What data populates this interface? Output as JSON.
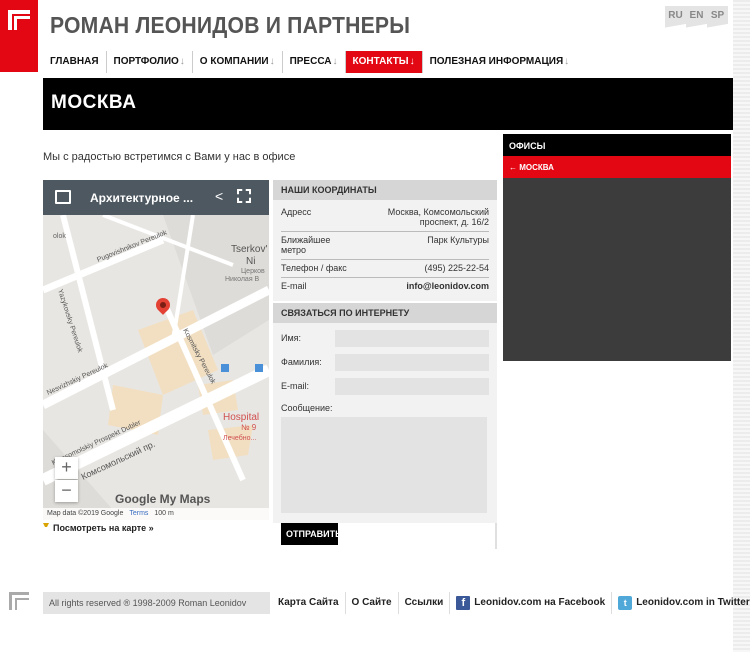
{
  "header": {
    "title": "РОМАН ЛЕОНИДОВ И ПАРТНЕРЫ",
    "langs": [
      "RU",
      "EN",
      "SP"
    ]
  },
  "nav": {
    "items": [
      {
        "label": "ГЛАВНАЯ",
        "arrow": ""
      },
      {
        "label": "ПОРТФОЛИО",
        "arrow": "↓"
      },
      {
        "label": "О КОМПАНИИ",
        "arrow": "↓"
      },
      {
        "label": "ПРЕССА",
        "arrow": "↓"
      },
      {
        "label": "КОНТАКТЫ",
        "arrow": "↓"
      },
      {
        "label": "ПОЛЕЗНАЯ ИНФОРМАЦИЯ",
        "arrow": "↓"
      }
    ],
    "active_index": 4
  },
  "page": {
    "heading": "МОСКВА",
    "intro": "Мы с радостью встретимся с Вами у нас в офисе"
  },
  "map": {
    "title": "Архитектурное ...",
    "zoom_in": "+",
    "zoom_out": "−",
    "brand": "Google My Maps",
    "attribution": "Map data ©2019 Google",
    "terms": "Terms",
    "scale": "100 m",
    "view_link": "Посмотреть на карте »",
    "labels": {
      "street1": "Pugovishnikov Pereulok",
      "street2": "Yazykovsky Pereulok",
      "street3": "Nesvizhskiy Pereulok",
      "street4": "Komsomolskiy Prospekt Dubler",
      "street5": "Комсомольский пр.",
      "street6": "Kosmitsky Pereulok",
      "place1": "Tserkov' S",
      "place2": "Ni",
      "place3": "Церков",
      "place4": "Николая В",
      "place5": "Hospital",
      "place6": "№ 9",
      "place7": "Лечебно...",
      "street7": "olok"
    }
  },
  "coords": {
    "heading": "НАШИ КООРДИНАТЫ",
    "rows": [
      {
        "key": "Адресс",
        "value": "Москва, Комсомольский проспект, д. 16/2"
      },
      {
        "key": "Ближайшее метро",
        "value": "Парк Культуры"
      },
      {
        "key": "Телефон / факс",
        "value": "(495) 225-22-54"
      },
      {
        "key": "E-mail",
        "value": "info@leonidov.com"
      }
    ]
  },
  "contact_form": {
    "heading": "СВЯЗАТЬСЯ ПО ИНТЕРНЕТУ",
    "name_label": "Имя:",
    "surname_label": "Фамилия:",
    "email_label": "E-mail:",
    "message_label": "Сообщение:",
    "submit": "ОТПРАВИТЬ"
  },
  "sidebar": {
    "heading": "ОФИСЫ",
    "items": [
      {
        "label": "МОСКВА",
        "arrow": "←"
      }
    ]
  },
  "footer": {
    "copyright": "All rights reserved ® 1998-2009 Roman Leonidov",
    "links": [
      "Карта Сайта",
      "О Сайте",
      "Ссылки"
    ],
    "facebook": "Leonidov.com на Facebook",
    "twitter": "Leonidov.com in Twitter",
    "fb_glyph": "f",
    "tw_glyph": "t"
  },
  "colors": {
    "accent": "#e30613",
    "dark": "#000000",
    "panel": "#f2f2f2"
  }
}
